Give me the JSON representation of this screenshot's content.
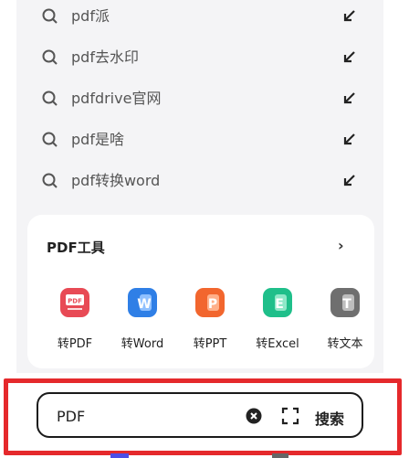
{
  "suggestions": [
    {
      "label": "pdf派"
    },
    {
      "label": "pdf去水印"
    },
    {
      "label": "pdfdrive官网"
    },
    {
      "label": "pdf是啥"
    },
    {
      "label": "pdf转换word"
    }
  ],
  "tools": {
    "title": "PDF工具",
    "more": "›",
    "items": [
      {
        "name": "转PDF",
        "icon": "pdf-convert-icon",
        "color": "#e84a55",
        "glyph": "PDF"
      },
      {
        "name": "转Word",
        "icon": "word-convert-icon",
        "color": "#2f7fe6",
        "glyph": "W"
      },
      {
        "name": "转PPT",
        "icon": "ppt-convert-icon",
        "color": "#f2662e",
        "glyph": "P"
      },
      {
        "name": "转Excel",
        "icon": "excel-convert-icon",
        "color": "#1fbf8a",
        "glyph": "E"
      },
      {
        "name": "转文本",
        "icon": "text-convert-icon",
        "color": "#6f6f6f",
        "glyph": "T"
      }
    ]
  },
  "search": {
    "query": "PDF",
    "button": "搜索"
  }
}
